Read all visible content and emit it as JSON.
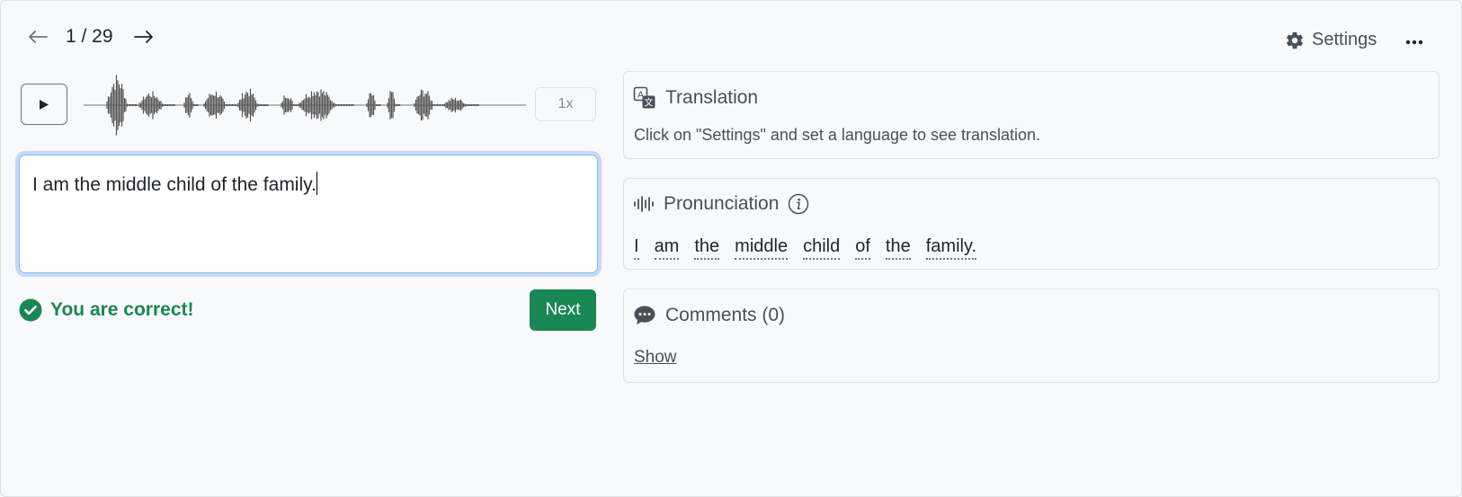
{
  "nav": {
    "prev_icon": "arrow-left-icon",
    "counter": "1 / 29",
    "next_icon": "arrow-right-icon",
    "settings_label": "Settings",
    "settings_icon": "gear-icon",
    "more_icon": "more-horizontal-icon"
  },
  "player": {
    "play_icon": "play-icon",
    "speed": "1x"
  },
  "answer": {
    "text": "I am the middle child of the family."
  },
  "result": {
    "message": "You are correct!",
    "icon": "check-circle-icon",
    "next_label": "Next"
  },
  "translation": {
    "title": "Translation",
    "icon": "translate-icon",
    "hint": "Click on \"Settings\" and set a language to see translation."
  },
  "pronunciation": {
    "title": "Pronunciation",
    "icon": "soundwave-icon",
    "info_icon": "info-icon",
    "words": [
      "I",
      "am",
      "the",
      "middle",
      "child",
      "of",
      "the",
      "family."
    ]
  },
  "comments": {
    "title": "Comments (0)",
    "icon": "chat-bubble-icon",
    "show_label": "Show"
  },
  "colors": {
    "success": "#198754",
    "focus_border": "#86b7fe",
    "background": "#f8f9fa"
  }
}
